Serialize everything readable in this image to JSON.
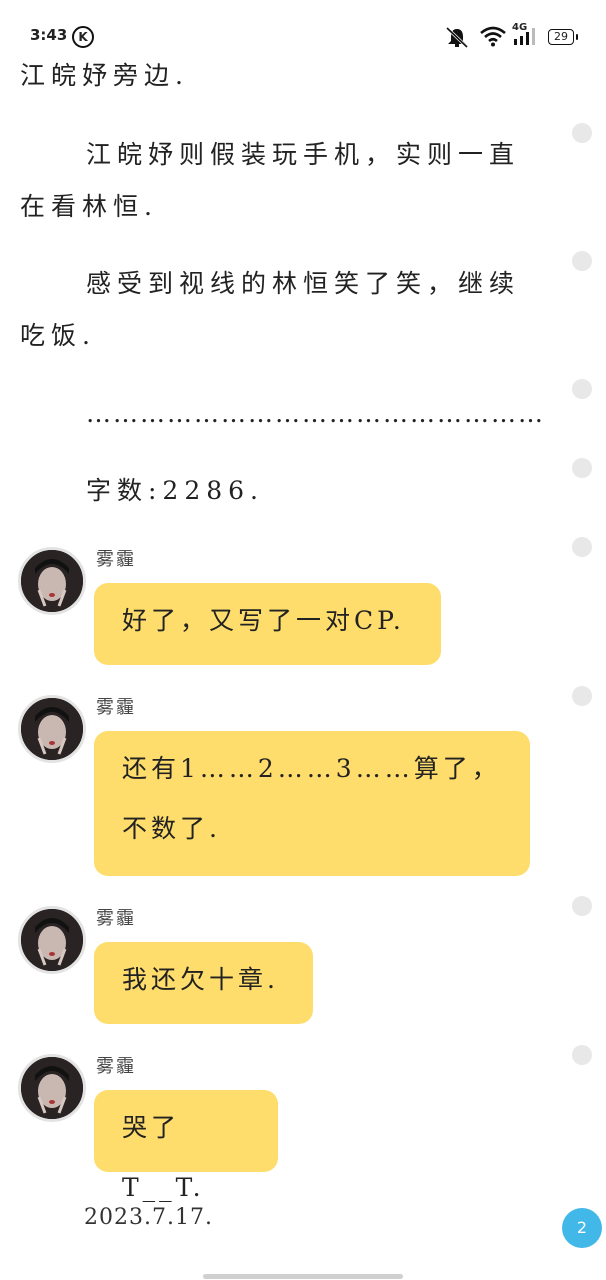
{
  "status_bar": {
    "time": "3:43",
    "k_icon": "K",
    "network": "4G",
    "battery": "29"
  },
  "story": {
    "paragraphs": [
      "江皖妤旁边.",
      "江皖妤则假装玩手机，实则一直在看林恒.",
      "感受到视线的林恒笑了笑，继续吃饭.",
      "……………………………………………",
      "字数:2286."
    ]
  },
  "chat": {
    "messages": [
      {
        "author": "雾霾",
        "text": "好了，又写了一对CP."
      },
      {
        "author": "雾霾",
        "text": "还有1……2……3……算了，不数了."
      },
      {
        "author": "雾霾",
        "text": "我还欠十章."
      },
      {
        "author": "雾霾",
        "text": "哭了T__T."
      }
    ]
  },
  "footer": {
    "date": "2023.7.17.",
    "page_badge": "2"
  },
  "colors": {
    "bubble": "#fedd6c",
    "badge": "#42b8e9",
    "background": "#ffffff"
  },
  "icons": [
    "k-icon",
    "mute-icon",
    "wifi-icon",
    "signal-icon",
    "battery-icon"
  ]
}
